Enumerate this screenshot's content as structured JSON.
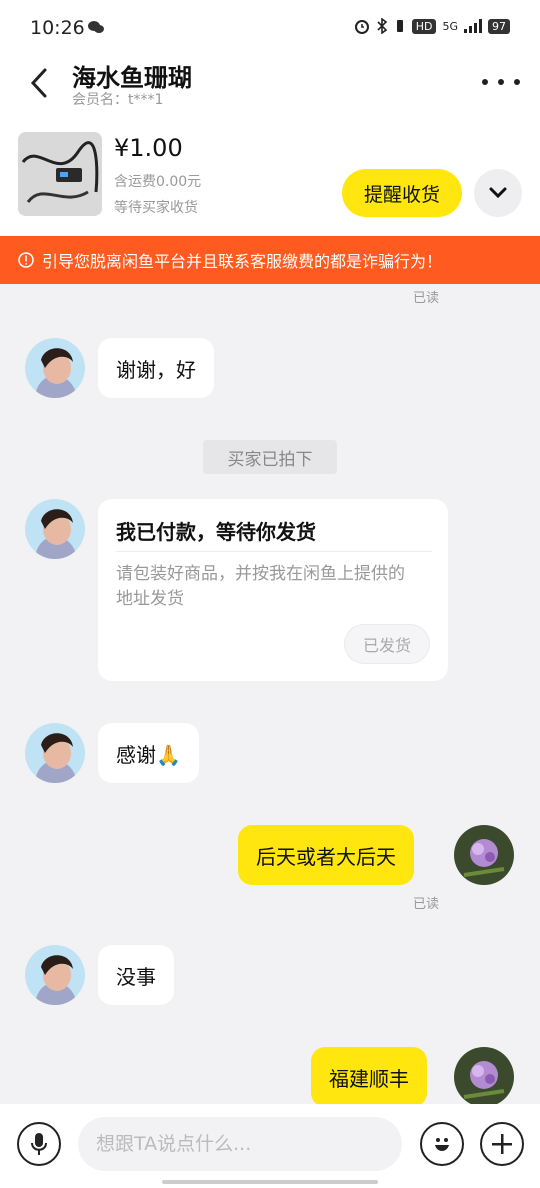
{
  "status_bar": {
    "time": "10:26",
    "network": "5G",
    "hd": "HD",
    "battery": "97"
  },
  "header": {
    "title": "海水鱼珊瑚",
    "member": "会员名：t***1"
  },
  "product": {
    "price": "¥1.00",
    "shipping": "含运费0.00元",
    "status": "等待买家收货",
    "remind_label": "提醒收货"
  },
  "warning": {
    "text": "引导您脱离闲鱼平台并且联系客服缴费的都是诈骗行为！"
  },
  "messages": {
    "read_label": "已读",
    "m1": "谢谢，好",
    "system_tag": "买家已拍下",
    "pay_card": {
      "title": "我已付款，等待你发货",
      "desc": "请包装好商品，并按我在闲鱼上提供的地址发货",
      "button": "已发货"
    },
    "m2": "感谢🙏",
    "m3": "后天或者大后天",
    "m4": "没事",
    "m5": "福建顺丰"
  },
  "input_bar": {
    "placeholder": "想跟TA说点什么..."
  },
  "colors": {
    "accent": "#ffe60f",
    "warning": "#ff5a1f",
    "background": "#f2f2f4"
  }
}
